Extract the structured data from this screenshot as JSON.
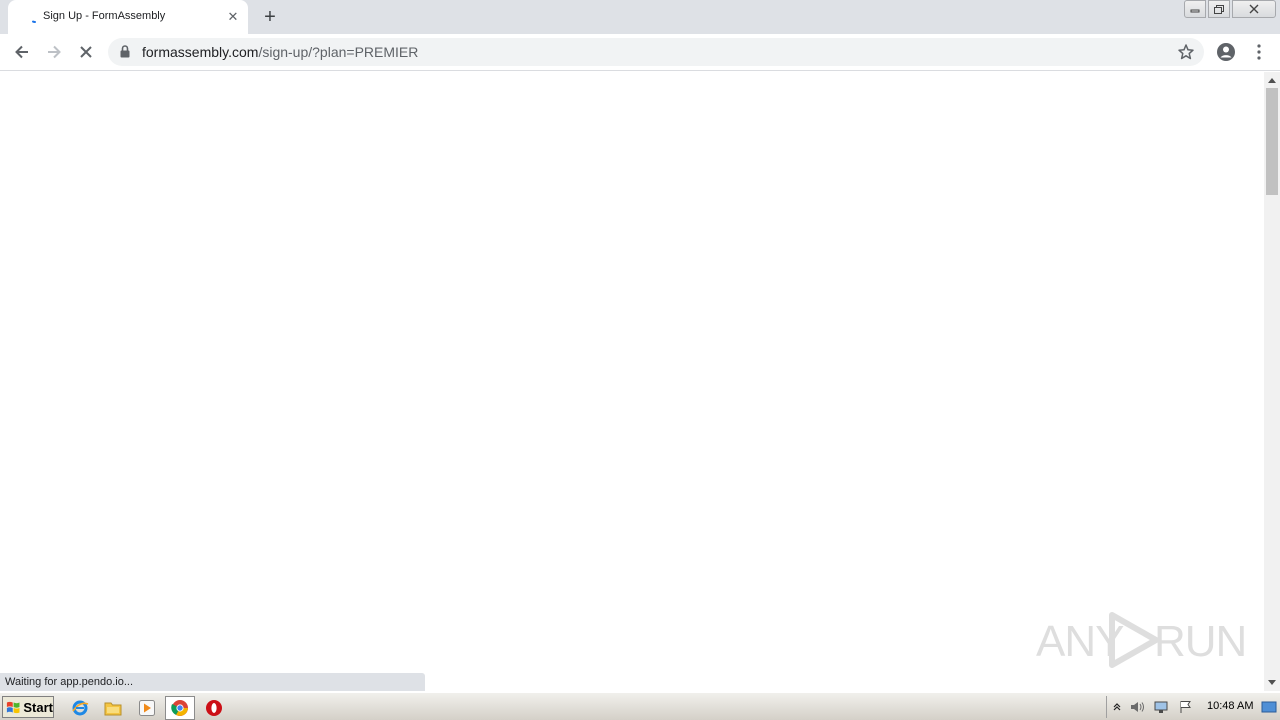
{
  "browser": {
    "tab": {
      "title": "Sign Up - FormAssembly"
    },
    "new_tab_symbol": "+",
    "close_symbol": "✕",
    "omnibox": {
      "domain": "formassembly.com",
      "path": "/sign-up/?plan=PREMIER"
    },
    "status": "Waiting for app.pendo.io..."
  },
  "watermark": {
    "left": "ANY",
    "right": "RUN"
  },
  "taskbar": {
    "start_label": "Start",
    "clock": "10:48 AM",
    "icons": [
      "internet-explorer-icon",
      "file-explorer-icon",
      "media-player-icon",
      "chrome-icon",
      "opera-icon"
    ]
  },
  "colors": {
    "tabstrip": "#dee1e6",
    "omnibox": "#f1f3f4",
    "accent_blue": "#1a73e8",
    "taskbar": "#d4d0c8"
  }
}
